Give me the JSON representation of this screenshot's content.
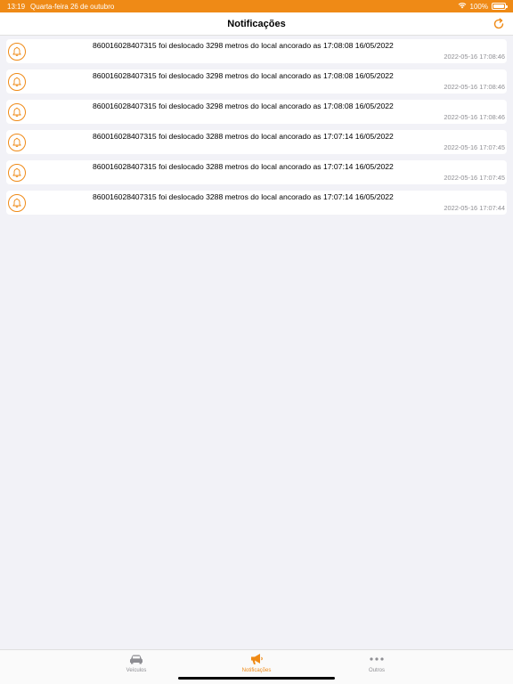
{
  "status_bar": {
    "time": "13:19",
    "date": "Quarta-feira 26 de outubro",
    "battery": "100%",
    "wifi_icon": "wifi-icon",
    "battery_icon": "battery-icon"
  },
  "header": {
    "title": "Notificações",
    "refresh_icon": "refresh-icon"
  },
  "colors": {
    "accent": "#ef8a16",
    "background": "#f2f2f7",
    "secondary_text": "#8e8e93"
  },
  "notifications": [
    {
      "message": "860016028407315 foi deslocado 3298 metros do local ancorado as 17:08:08 16/05/2022",
      "time": "2022-05-16 17:08:46",
      "icon": "bell-icon"
    },
    {
      "message": "860016028407315 foi deslocado 3298 metros do local ancorado as 17:08:08 16/05/2022",
      "time": "2022-05-16 17:08:46",
      "icon": "bell-icon"
    },
    {
      "message": "860016028407315 foi deslocado 3298 metros do local ancorado as 17:08:08 16/05/2022",
      "time": "2022-05-16 17:08:46",
      "icon": "bell-icon"
    },
    {
      "message": "860016028407315 foi deslocado 3288 metros do local ancorado as 17:07:14 16/05/2022",
      "time": "2022-05-16 17:07:45",
      "icon": "bell-icon"
    },
    {
      "message": "860016028407315 foi deslocado 3288 metros do local ancorado as 17:07:14 16/05/2022",
      "time": "2022-05-16 17:07:45",
      "icon": "bell-icon"
    },
    {
      "message": "860016028407315 foi deslocado 3288 metros do local ancorado as 17:07:14 16/05/2022",
      "time": "2022-05-16 17:07:44",
      "icon": "bell-icon"
    }
  ],
  "tabs": [
    {
      "label": "Veículos",
      "icon": "car-icon",
      "active": false
    },
    {
      "label": "Notificações",
      "icon": "megaphone-icon",
      "active": true
    },
    {
      "label": "Outros",
      "icon": "more-icon",
      "active": false
    }
  ]
}
